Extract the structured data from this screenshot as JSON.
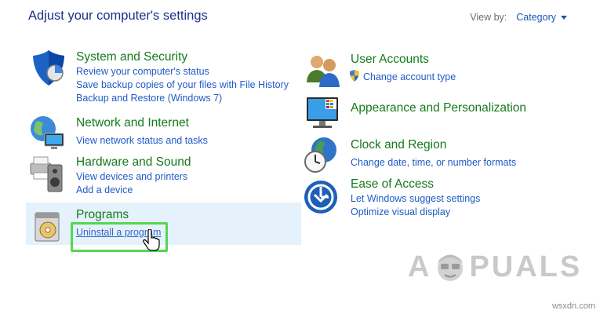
{
  "header": {
    "title": "Adjust your computer's settings",
    "view_by_label": "View by:",
    "view_by_value": "Category"
  },
  "left_categories": [
    {
      "title": "System and Security",
      "icon": "shield-icon",
      "links": [
        "Review your computer's status",
        "Save backup copies of your files with File History",
        "Backup and Restore (Windows 7)"
      ]
    },
    {
      "title": "Network and Internet",
      "icon": "network-globe-icon",
      "links": [
        "View network status and tasks"
      ]
    },
    {
      "title": "Hardware and Sound",
      "icon": "printer-speaker-icon",
      "links": [
        "View devices and printers",
        "Add a device"
      ]
    },
    {
      "title": "Programs",
      "icon": "programs-disc-icon",
      "links": [
        "Uninstall a program"
      ]
    }
  ],
  "right_categories": [
    {
      "title": "User Accounts",
      "icon": "users-icon",
      "links": [
        "Change account type"
      ],
      "link_icon": "uac-shield-icon"
    },
    {
      "title": "Appearance and Personalization",
      "icon": "monitor-palette-icon",
      "links": []
    },
    {
      "title": "Clock and Region",
      "icon": "clock-globe-icon",
      "links": [
        "Change date, time, or number formats"
      ]
    },
    {
      "title": "Ease of Access",
      "icon": "ease-of-access-icon",
      "links": [
        "Let Windows suggest settings",
        "Optimize visual display"
      ]
    }
  ],
  "watermark": {
    "left": "A",
    "right": "PUALS"
  },
  "site_credit": "wsxdn.com",
  "colors": {
    "title_blue": "#1e3287",
    "category_green": "#157a1c",
    "link_blue": "#1f5bc6",
    "hover_bg": "#e5f1fb",
    "highlight_green": "#55d655"
  }
}
